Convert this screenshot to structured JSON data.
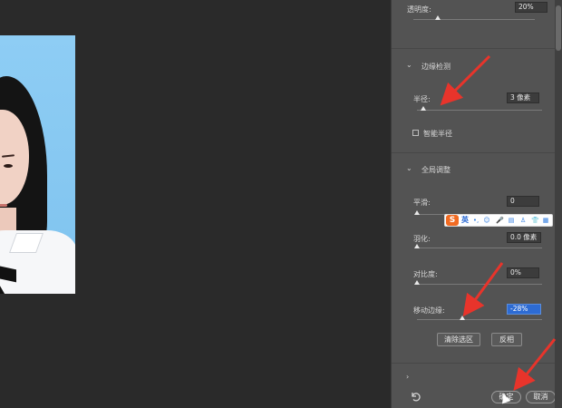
{
  "panel": {
    "opacity": {
      "label": "透明度:",
      "value": "20%",
      "slider_fraction": 0.2
    },
    "edge_detection": {
      "title": "边缘检测",
      "radius": {
        "label": "半径:",
        "value": "3 像素",
        "slider_fraction": 0.05
      },
      "smart_radius": {
        "label": "智能半径",
        "checked": false
      }
    },
    "global_refinements": {
      "title": "全局调整",
      "smooth": {
        "label": "平滑:",
        "value": "0",
        "slider_fraction": 0.0
      },
      "feather": {
        "label": "羽化:",
        "value": "0.0 像素",
        "slider_fraction": 0.0
      },
      "contrast": {
        "label": "对比度:",
        "value": "0%",
        "slider_fraction": 0.0
      },
      "shift_edge": {
        "label": "移动边缘:",
        "value": "-28%",
        "slider_fraction": 0.36
      },
      "clear_selection_label": "清除选区",
      "invert_label": "反相"
    },
    "ok_label": "确定",
    "cancel_label": "取消"
  },
  "ime": {
    "logo": "S",
    "lang": "英"
  },
  "colors": {
    "panel_bg": "#535353",
    "canvas_bg": "#2a2a2a",
    "selection_blue": "#2d6bd3",
    "arrow_red": "#e8342b",
    "photo_bg": "#8ecdf4"
  },
  "icons": [
    "chevron-down-icon",
    "reset-icon",
    "cursor-icon",
    "sogou-ime-icon"
  ]
}
